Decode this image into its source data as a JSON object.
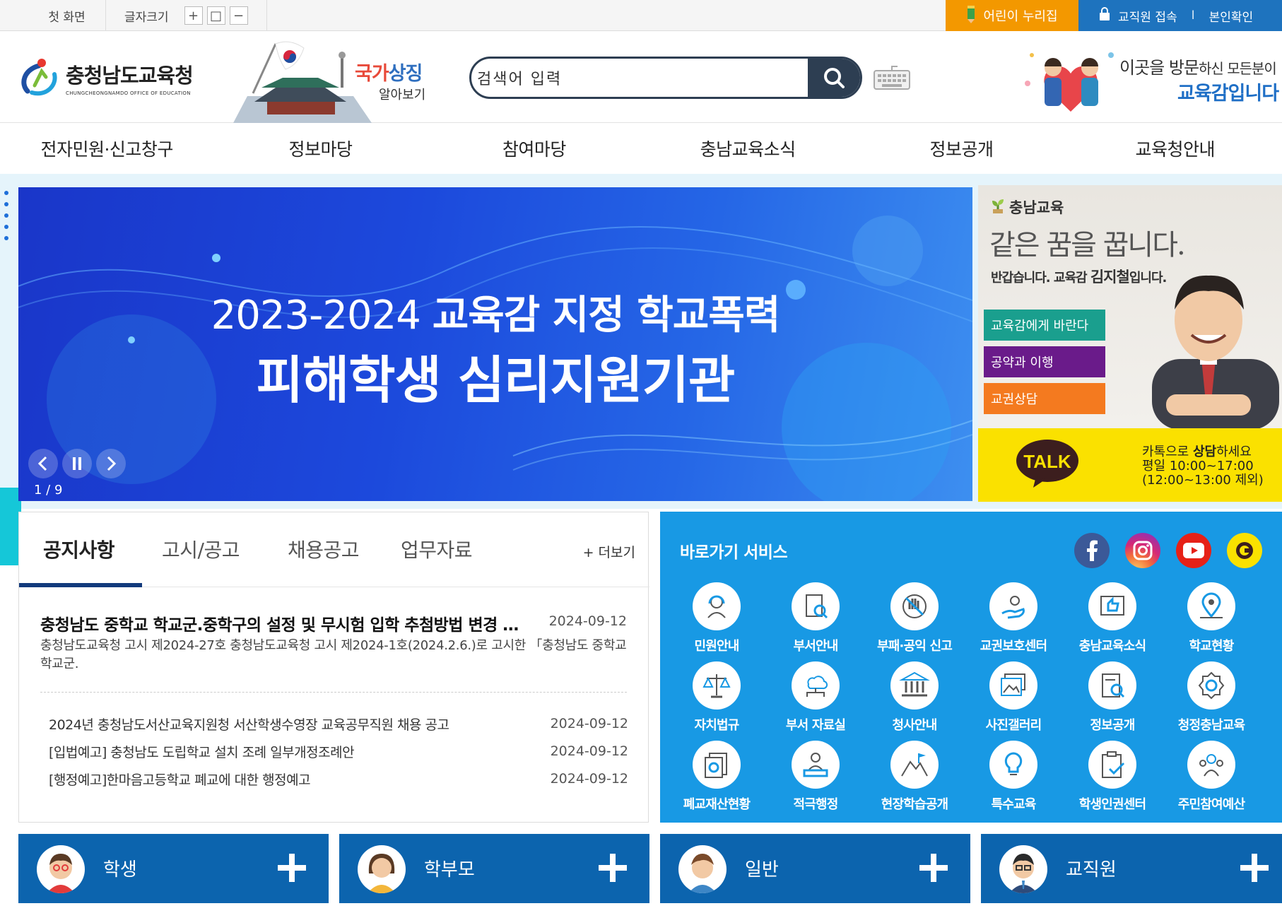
{
  "topbar": {
    "home": "첫 화면",
    "font_size_label": "글자크기",
    "font_plus": "+",
    "font_reset": "□",
    "font_minus": "−",
    "kids_link": "어린이 누리집",
    "staff_login": "교직원 접속",
    "separator": "I",
    "verify": "본인확인"
  },
  "header": {
    "logo_ko": "충청남도교육청",
    "logo_en": "CHUNGCHEONGNAMDO OFFICE OF EDUCATION",
    "symbol_title_a": "국가",
    "symbol_title_b": "상징",
    "symbol_sub": "알아보기",
    "search_value": "검색어 입력",
    "greeting_line1_a": "이곳을 방문",
    "greeting_line1_b": "하신 모든분이",
    "greeting_line2": "교육감입니다"
  },
  "gnb": [
    "전자민원·신고창구",
    "정보마당",
    "참여마당",
    "충남교육소식",
    "정보공개",
    "교육청안내"
  ],
  "hero": {
    "line1_light": "2023-2024",
    "line1_bold": "교육감 지정 학교폭력",
    "line2": "피해학생 심리지원기관",
    "counter": "1 / 9"
  },
  "superintendent": {
    "brand": "충남교육",
    "slogan": "같은 꿈을 꿉니다.",
    "hello_a": "반갑습니다. 교육감 ",
    "hello_name": "김지철",
    "hello_b": "입니다.",
    "buttons": [
      {
        "label": "교육감에게 바란다",
        "color": "#1a9f8e"
      },
      {
        "label": "공약과 이행",
        "color": "#6a1b8a"
      },
      {
        "label": "교권상담",
        "color": "#f47a1f"
      }
    ],
    "talk_badge": "TALK",
    "talk_line1_a": "카톡으로 ",
    "talk_line1_b": "상담",
    "talk_line1_c": "하세요",
    "talk_line2": "평일 10:00~17:00",
    "talk_line3": "(12:00~13:00 제외)"
  },
  "notice": {
    "tabs": [
      "공지사항",
      "고시/공고",
      "채용공고",
      "업무자료"
    ],
    "more": "+ 더보기",
    "featured": {
      "title": "충청남도 중학교 학교군.중학구의 설정 및 무시험 입학 추첨방법 변경 고시",
      "date": "2024-09-12",
      "desc": "충청남도교육청 고시 제2024-27호 충청남도교육청 고시 제2024-1호(2024.2.6.)로 고시한 「충청남도 중학교 학교군."
    },
    "items": [
      {
        "title": "2024년 충청남도서산교육지원청 서산학생수영장 교육공무직원 채용 공고",
        "date": "2024-09-12"
      },
      {
        "title": "[입법예고] 충청남도 도립학교 설치 조례 일부개정조례안",
        "date": "2024-09-12"
      },
      {
        "title": "[행정예고]한마음고등학교 폐교에 대한 행정예고",
        "date": "2024-09-12"
      }
    ]
  },
  "quick": {
    "title": "바로가기 서비스",
    "sns": [
      "facebook-icon",
      "instagram-icon",
      "youtube-icon",
      "kakao-channel-icon"
    ],
    "items": [
      "민원안내",
      "부서안내",
      "부패·공익 신고",
      "교권보호센터",
      "충남교육소식",
      "학교현황",
      "자치법규",
      "부서 자료실",
      "청사안내",
      "사진갤러리",
      "정보공개",
      "청정충남교육",
      "폐교재산현황",
      "적극행정",
      "현장학습공개",
      "특수교육",
      "학생인권센터",
      "주민참여예산"
    ]
  },
  "user_types": [
    "학생",
    "학부모",
    "일반",
    "교직원"
  ],
  "colors": {
    "kids": "#f39800",
    "staff": "#1e73be",
    "quick_bg": "#1899e4",
    "user_btn": "#0c64ae",
    "tab_underline": "#123a7c",
    "talk_bg": "#fae100"
  }
}
